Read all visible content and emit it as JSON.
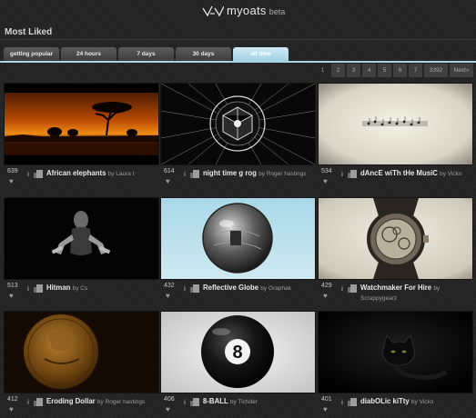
{
  "header": {
    "logo_text": "myoats",
    "logo_badge": "beta"
  },
  "section": {
    "title": "Most Liked"
  },
  "tabs": [
    {
      "label": "getting popular"
    },
    {
      "label": "24 hours"
    },
    {
      "label": "7 days"
    },
    {
      "label": "30 days"
    },
    {
      "label": "all time"
    }
  ],
  "pagination": {
    "pages": [
      "1",
      "2",
      "3",
      "4",
      "5",
      "6",
      "7",
      "3392"
    ],
    "next": "Next»"
  },
  "artworks": [
    {
      "likes": "639",
      "title": "African elephants",
      "by": "by Laura t"
    },
    {
      "likes": "614",
      "title": "night time g rog",
      "by": "by Roger hastings"
    },
    {
      "likes": "534",
      "title": "dAncE wiTh tHe MusiC",
      "by": "by Vicko"
    },
    {
      "likes": "513",
      "title": "Hitman",
      "by": "by Cs"
    },
    {
      "likes": "432",
      "title": "Reflective Globe",
      "by": "by Graphak"
    },
    {
      "likes": "429",
      "title": "Watchmaker For Hire",
      "by": "by Scrappygearz"
    },
    {
      "likes": "412",
      "title": "Eroding Dollar",
      "by": "by Roger hastings"
    },
    {
      "likes": "406",
      "title": "8-BALL",
      "by": "by Tichder"
    },
    {
      "likes": "401",
      "title": "diabOLic kiTty",
      "by": "by Vicko"
    }
  ],
  "thumbnail_art": [
    "sunset-elephants",
    "radial-cube",
    "music-staff",
    "hitman-figure",
    "glass-globe",
    "pocket-watch",
    "gold-coin",
    "eight-ball",
    "black-cat"
  ],
  "icons": {
    "like": "heart-icon",
    "info": "info-icon",
    "remix": "fork-icon"
  },
  "colors": {
    "background": "#232323",
    "active_tab": "#a9d3e6",
    "tab": "#4a4a4a"
  }
}
